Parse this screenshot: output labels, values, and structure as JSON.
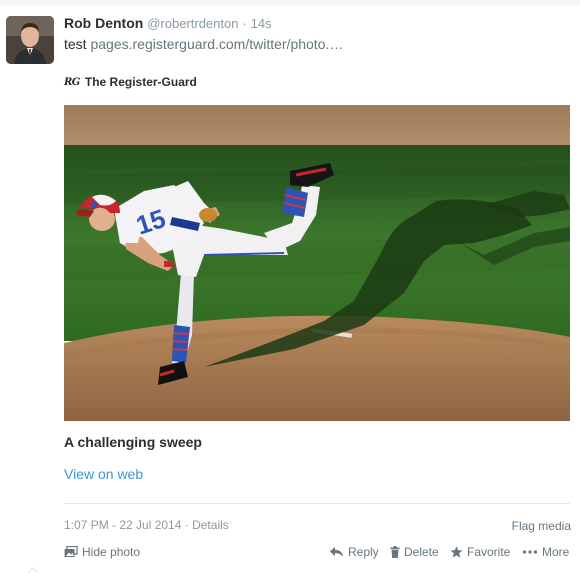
{
  "tweet": {
    "name": "Rob Denton",
    "handle": "@robertrdenton",
    "separator": "·",
    "time": "14s",
    "text_prefix": "test",
    "link": "pages.registerguard.com/twitter/photo.…"
  },
  "card": {
    "publisher_logo": "RG",
    "publisher_name": "The Register-Guard",
    "title": "A challenging sweep",
    "view_link": "View on web"
  },
  "footer": {
    "timestamp": "1:07 PM - 22 Jul 2014",
    "separator": "·",
    "details_label": "Details",
    "flag_label": "Flag media"
  },
  "actions": {
    "hide_photo": "Hide photo",
    "reply": "Reply",
    "delete": "Delete",
    "favorite": "Favorite",
    "more": "More"
  },
  "colors": {
    "link_blue": "#3b94d9",
    "muted_gray": "#8899a6",
    "text_dark": "#292f33"
  },
  "icons": [
    "photo-icon",
    "reply-icon",
    "trash-icon",
    "star-icon",
    "more-dots-icon",
    "caret-up-icon"
  ]
}
